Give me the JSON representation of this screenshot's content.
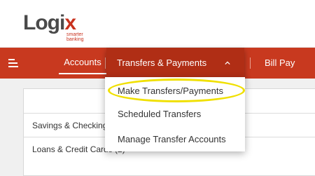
{
  "brand": {
    "logo_text_a": "Logi",
    "logo_text_b": "x",
    "tagline_1": "smarter",
    "tagline_2": "banking"
  },
  "nav": {
    "accounts_label": "Accounts",
    "transfers_label": "Transfers & Payments",
    "billpay_label": "Bill Pay"
  },
  "dropdown": {
    "items": [
      {
        "label": "Make Transfers/Payments"
      },
      {
        "label": "Scheduled Transfers"
      },
      {
        "label": "Manage Transfer Accounts"
      }
    ]
  },
  "accounts": {
    "rows": [
      {
        "label": "Savings & Checking"
      },
      {
        "label": "Loans & Credit Cards (2)"
      }
    ]
  },
  "colors": {
    "brand_red": "#c8391f",
    "active_red": "#b02e15",
    "highlight": "#f0e000"
  }
}
